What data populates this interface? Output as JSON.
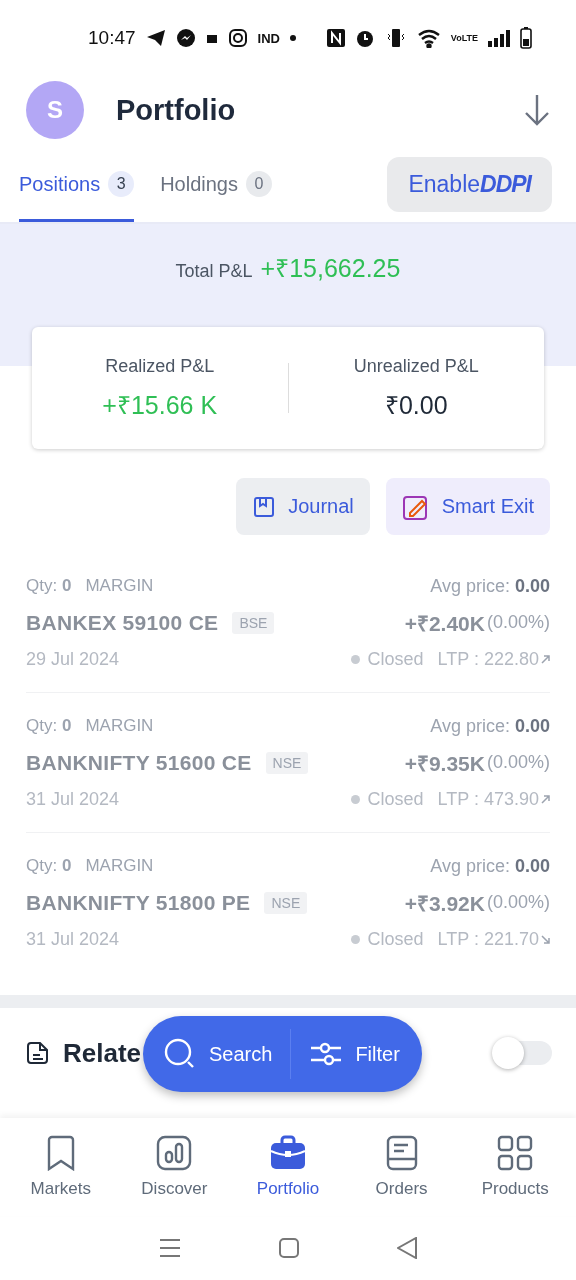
{
  "status_bar": {
    "time": "10:47",
    "carrier_tag": "IND",
    "network_tag": "VoLTE"
  },
  "header": {
    "avatar": "S",
    "title": "Portfolio"
  },
  "tabs": [
    {
      "label": "Positions",
      "count": "3",
      "selected": true
    },
    {
      "label": "Holdings",
      "count": "0",
      "selected": false
    }
  ],
  "ddpi_button": "Enable**DDPI**",
  "summary": {
    "total_label": "Total P&L",
    "total_value": "+₹15,662.25",
    "realized_label": "Realized P&L",
    "realized_value": "+₹15.66 K",
    "unrealized_label": "Unrealized P&L",
    "unrealized_value": "₹0.00"
  },
  "actions": [
    {
      "kind": "journal",
      "label": "Journal"
    },
    {
      "kind": "smart_exit",
      "label": "Smart Exit"
    }
  ],
  "positions": [
    {
      "qty": "Qty: **0**",
      "product": "MARGIN",
      "avg": "Avg price: **0.00**",
      "symbol": "BANKEX 59100 CE",
      "exchange": "BSE",
      "pnl": "+₹2.40K",
      "pct": "(0.00%)",
      "date": "29 Jul 2024",
      "status": "Closed",
      "ltp": "LTP : 222.80",
      "rising": true
    },
    {
      "qty": "Qty: **0**",
      "product": "MARGIN",
      "avg": "Avg price: **0.00**",
      "symbol": "BANKNIFTY 51600 CE",
      "exchange": "NSE",
      "pnl": "+₹9.35K",
      "pct": "(0.00%)",
      "date": "31 Jul 2024",
      "status": "Closed",
      "ltp": "LTP : 473.90",
      "rising": true
    },
    {
      "qty": "Qty: **0**",
      "product": "MARGIN",
      "avg": "Avg price: **0.00**",
      "symbol": "BANKNIFTY 51800 PE",
      "exchange": "NSE",
      "pnl": "+₹3.92K",
      "pct": "(0.00%)",
      "date": "31 Jul 2024",
      "status": "Closed",
      "ltp": "LTP : 221.70",
      "rising": false
    }
  ],
  "related": {
    "title": "Relate",
    "on": false
  },
  "floating_bar": [
    {
      "kind": "search",
      "label": "Search"
    },
    {
      "kind": "filter",
      "label": "Filter"
    }
  ],
  "bottom_nav": [
    {
      "kind": "markets",
      "label": "Markets",
      "selected": false
    },
    {
      "kind": "discover",
      "label": "Discover",
      "selected": false
    },
    {
      "kind": "portfolio",
      "label": "Portfolio",
      "selected": true
    },
    {
      "kind": "orders",
      "label": "Orders",
      "selected": false
    },
    {
      "kind": "products",
      "label": "Products",
      "selected": false
    }
  ]
}
